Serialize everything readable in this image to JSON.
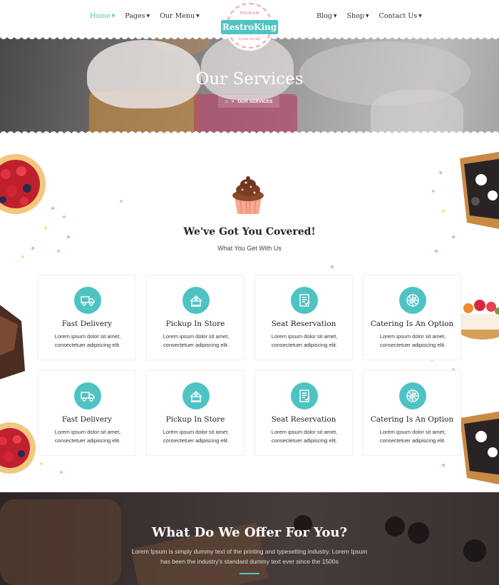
{
  "nav": {
    "left": [
      {
        "label": "Home",
        "active": true
      },
      {
        "label": "Pages"
      },
      {
        "label": "Our Menu"
      }
    ],
    "right": [
      {
        "label": "Blog"
      },
      {
        "label": "Shop"
      },
      {
        "label": "Contact Us"
      }
    ],
    "logo": {
      "brand": "RestroKing",
      "top_text": "PREMIUM",
      "bottom_text": "HAND MADE"
    }
  },
  "hero": {
    "title": "Our Services",
    "breadcrumb_current": "OUR SERVICES"
  },
  "services": {
    "title": "We've Got You Covered!",
    "subtitle": "What You Get With Us",
    "cards": [
      {
        "title": "Fast Delivery",
        "desc_line1": "Lorem ipsum dolor sit amet,",
        "desc_line2": "consectetuer adipiscing elit.",
        "icon": "delivery-truck-icon"
      },
      {
        "title": "Pickup In Store",
        "desc_line1": "Lorem ipsum dolor sit amet,",
        "desc_line2": "consectetuer adipiscing elit.",
        "icon": "store-pickup-icon"
      },
      {
        "title": "Seat Reservation",
        "desc_line1": "Lorem ipsum dolor sit amet,",
        "desc_line2": "consectetuer adipiscing elit.",
        "icon": "reservation-icon"
      },
      {
        "title": "Catering Is An Option",
        "desc_line1": "Lorem ipsum dolor sit amet,",
        "desc_line2": "consectetuer adipiscing elit.",
        "icon": "catering-pizza-icon"
      },
      {
        "title": "Fast Delivery",
        "desc_line1": "Lorem ipsum dolor sit amet,",
        "desc_line2": "consectetuer adipiscing elit.",
        "icon": "delivery-truck-icon"
      },
      {
        "title": "Pickup In Store",
        "desc_line1": "Lorem ipsum dolor sit amet,",
        "desc_line2": "consectetuer adipiscing elit.",
        "icon": "store-pickup-icon"
      },
      {
        "title": "Seat Reservation",
        "desc_line1": "Lorem ipsum dolor sit amet,",
        "desc_line2": "consectetuer adipiscing elit.",
        "icon": "reservation-icon"
      },
      {
        "title": "Catering Is An Option",
        "desc_line1": "Lorem ipsum dolor sit amet,",
        "desc_line2": "consectetuer adipiscing elit.",
        "icon": "catering-pizza-icon"
      }
    ]
  },
  "offer": {
    "title": "What Do We Offer For You?",
    "text_line1": "Lorem Ipsum is simply dummy text of the printing and typesetting industry. Lorem Ipsum",
    "text_line2": "has been the industry's standard dummy text ever since the 1500s"
  },
  "colors": {
    "accent": "#4fc3c3",
    "pink": "#e56b8a"
  }
}
